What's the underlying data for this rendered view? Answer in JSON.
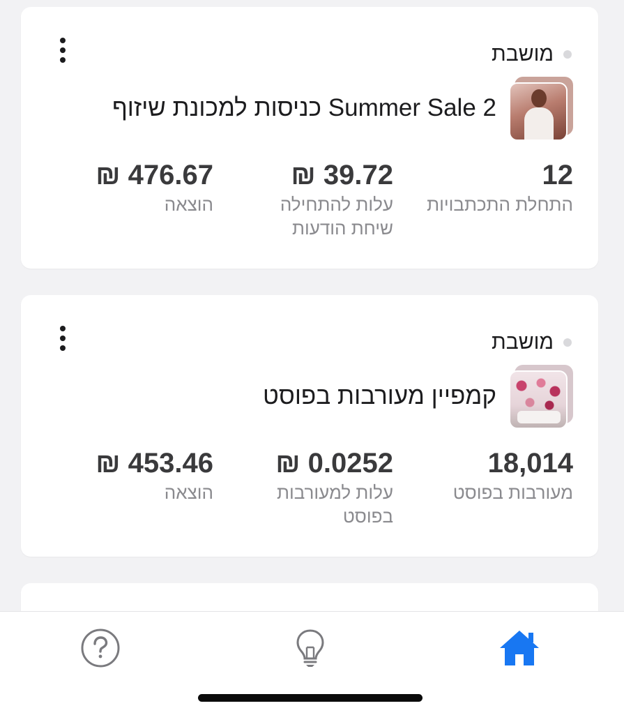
{
  "campaigns": [
    {
      "status": "מושבת",
      "title": "Summer Sale 2 כניסות למכונת שיזוף",
      "metrics": [
        {
          "value": "12",
          "label": "התחלת התכתבויות"
        },
        {
          "value": "39.72 ₪",
          "label": "עלות להתחילה שיחת הודעות"
        },
        {
          "value": "476.67 ₪",
          "label": "הוצאה"
        }
      ]
    },
    {
      "status": "מושבת",
      "title": "קמפיין מעורבות בפוסט",
      "metrics": [
        {
          "value": "18,014",
          "label": "מעורבות בפוסט"
        },
        {
          "value": "0.0252 ₪",
          "label": "עלות למעורבות בפוסט"
        },
        {
          "value": "453.46 ₪",
          "label": "הוצאה"
        }
      ]
    }
  ],
  "tab_bar": {
    "tabs": [
      {
        "icon": "help-circle-icon",
        "active": false
      },
      {
        "icon": "lightbulb-icon",
        "active": false
      },
      {
        "icon": "home-icon",
        "active": true
      }
    ],
    "active_color": "#1877f2",
    "inactive_color": "#7a7a7e"
  }
}
